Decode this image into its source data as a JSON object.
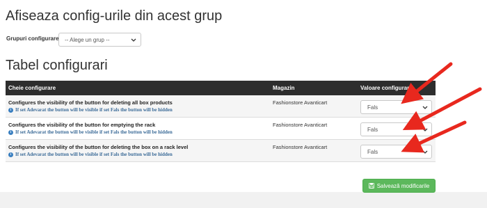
{
  "page": {
    "title": "Afiseaza config-urile din acest grup",
    "group_label": "Grupuri configurare",
    "group_select_value": "-- Alege un grup --",
    "section_title": "Tabel configurari"
  },
  "table": {
    "headers": {
      "key": "Cheie configurare",
      "store": "Magazin",
      "value": "Valoare configurare"
    },
    "rows": [
      {
        "key": "Configures the visibility of the button for deleting all box products",
        "hint": "If set Adevarat the button will be visible if set Fals the button will be hidden",
        "store": "Fashionstore Avanticart",
        "value": "Fals"
      },
      {
        "key": "Configures the visibility of the button for emptying the rack",
        "hint": "If set Adevarat the button will be visible if set Fals the button will be hidden",
        "store": "Fashionstore Avanticart",
        "value": "Fals"
      },
      {
        "key": "Configures the visibility of the button for deleting the box on a rack level",
        "hint": "If set Adevarat the button will be visible if set Fals the button will be hidden",
        "store": "Fashionstore Avanticart",
        "value": "Fals"
      }
    ]
  },
  "actions": {
    "save_label": "Salvează modificarile"
  },
  "icons": {
    "info": "info-icon",
    "save": "floppy-disk-icon",
    "dropdown": "chevron-down-icon",
    "annotation": "red-arrow"
  },
  "colors": {
    "header_bg": "#2d2d2d",
    "hint_text": "#3a6a97",
    "save_button": "#5cb85c",
    "annotation_arrow": "#e8281e"
  }
}
